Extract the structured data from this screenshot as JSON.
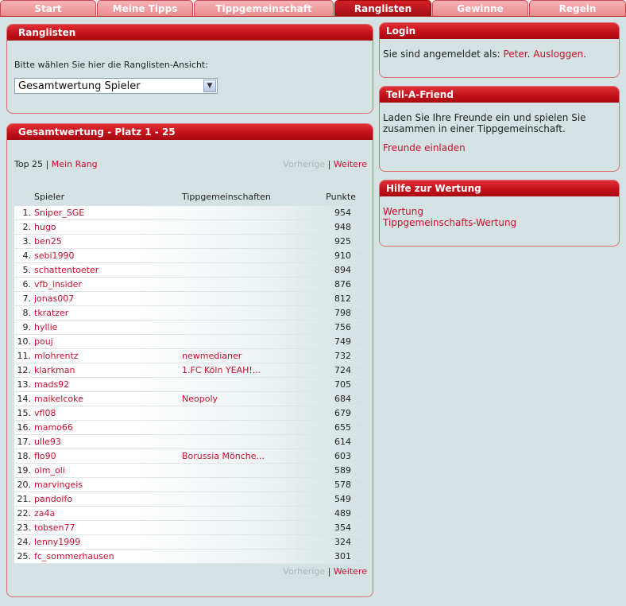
{
  "nav": {
    "tabs": [
      {
        "label": "Start",
        "active": false
      },
      {
        "label": "Meine Tipps",
        "active": false
      },
      {
        "label": "Tippgemeinschaft",
        "active": false
      },
      {
        "label": "Ranglisten",
        "active": true
      },
      {
        "label": "Gewinne",
        "active": false
      },
      {
        "label": "Regeln",
        "active": false
      }
    ]
  },
  "ranglisten": {
    "title": "Ranglisten",
    "prompt": "Bitte wählen Sie hier die Ranglisten-Ansicht:",
    "select_value": "Gesamtwertung Spieler"
  },
  "gesamt": {
    "title": "Gesamtwertung - Platz 1 - 25",
    "top_label": "Top 25",
    "sep": "|",
    "mein_rang": "Mein Rang",
    "prev": "Vorherige",
    "next": "Weitere",
    "col_player": "Spieler",
    "col_group": "Tippgemeinschaften",
    "col_points": "Punkte",
    "rows": [
      {
        "pos": "1.",
        "player": "Sniper_SGE",
        "group": "",
        "points": "954"
      },
      {
        "pos": "2.",
        "player": "hugo",
        "group": "",
        "points": "948"
      },
      {
        "pos": "3.",
        "player": "ben25",
        "group": "",
        "points": "925"
      },
      {
        "pos": "4.",
        "player": "sebi1990",
        "group": "",
        "points": "910"
      },
      {
        "pos": "5.",
        "player": "schattentoeter",
        "group": "",
        "points": "894"
      },
      {
        "pos": "6.",
        "player": "vfb_insider",
        "group": "",
        "points": "876"
      },
      {
        "pos": "7.",
        "player": "jonas007",
        "group": "",
        "points": "812"
      },
      {
        "pos": "8.",
        "player": "tkratzer",
        "group": "",
        "points": "798"
      },
      {
        "pos": "9.",
        "player": "hyllie",
        "group": "",
        "points": "756"
      },
      {
        "pos": "10.",
        "player": "pouj",
        "group": "",
        "points": "749"
      },
      {
        "pos": "11.",
        "player": "mlohrentz",
        "group": "newmedianer",
        "points": "732"
      },
      {
        "pos": "12.",
        "player": "klarkman",
        "group": "1.FC Köln YEAH!...",
        "points": "724"
      },
      {
        "pos": "13.",
        "player": "mads92",
        "group": "",
        "points": "705"
      },
      {
        "pos": "14.",
        "player": "maikelcoke",
        "group": "Neopoly",
        "points": "684"
      },
      {
        "pos": "15.",
        "player": "vfl08",
        "group": "",
        "points": "679"
      },
      {
        "pos": "16.",
        "player": "mamo66",
        "group": "",
        "points": "655"
      },
      {
        "pos": "17.",
        "player": "ulle93",
        "group": "",
        "points": "614"
      },
      {
        "pos": "18.",
        "player": "flo90",
        "group": "Borussia Mönche...",
        "points": "603"
      },
      {
        "pos": "19.",
        "player": "olm_oli",
        "group": "",
        "points": "589"
      },
      {
        "pos": "20.",
        "player": "marvingeis",
        "group": "",
        "points": "578"
      },
      {
        "pos": "21.",
        "player": "pandolfo",
        "group": "",
        "points": "549"
      },
      {
        "pos": "22.",
        "player": "za4a",
        "group": "",
        "points": "489"
      },
      {
        "pos": "23.",
        "player": "tobsen77",
        "group": "",
        "points": "354"
      },
      {
        "pos": "24.",
        "player": "lenny1999",
        "group": "",
        "points": "324"
      },
      {
        "pos": "25.",
        "player": "fc_sommerhausen",
        "group": "",
        "points": "301"
      }
    ]
  },
  "login": {
    "title": "Login",
    "text": "Sie sind angemeldet als:",
    "user": "Peter",
    "dot": ".",
    "logout": "Ausloggen",
    "dot2": "."
  },
  "tell": {
    "title": "Tell-A-Friend",
    "line1": "Laden Sie Ihre Freunde ein und spielen Sie",
    "line2": "zusammen in einer Tippgemeinschaft.",
    "link": "Freunde einladen"
  },
  "hilfe": {
    "title": "Hilfe zur Wertung",
    "link1": "Wertung",
    "link2": "Tippgemeinschafts-Wertung"
  },
  "colors": {
    "accent": "#c8102e",
    "header_red": "#c4101a",
    "background": "#d4e2e4"
  }
}
